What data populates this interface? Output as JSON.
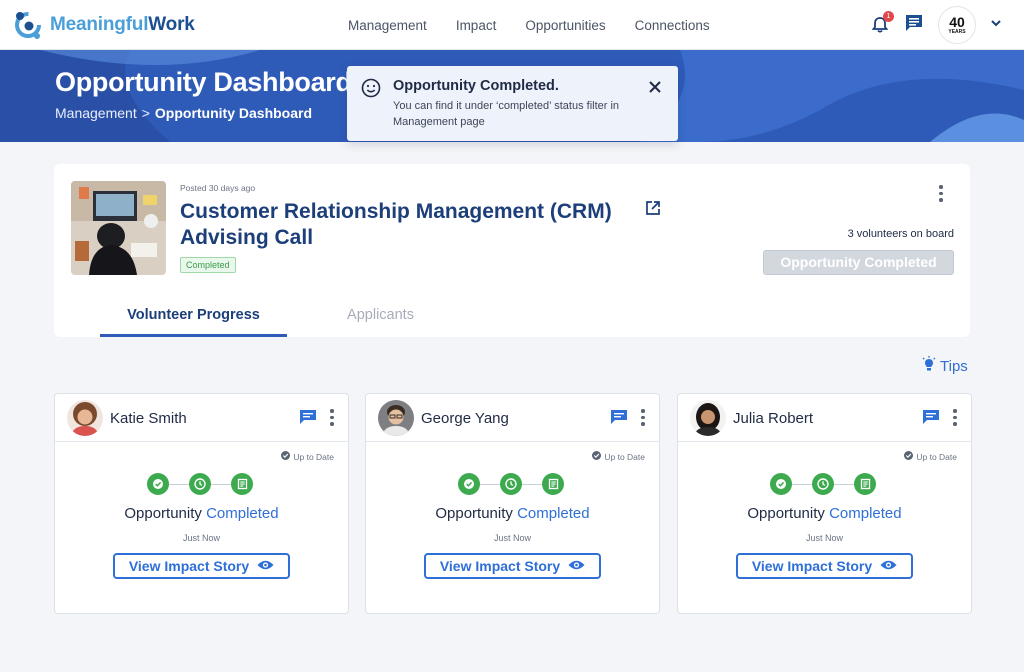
{
  "brand": {
    "name_part1": "Meaningful",
    "name_part2": "Work"
  },
  "nav": {
    "links": [
      "Management",
      "Impact",
      "Opportunities",
      "Connections"
    ],
    "notification_count": "1",
    "org_badge_big": "40",
    "org_badge_small": "YEARS"
  },
  "banner": {
    "title": "Opportunity Dashboard",
    "breadcrumb_parent": "Management",
    "breadcrumb_sep": ">",
    "breadcrumb_current": "Opportunity Dashboard"
  },
  "toast": {
    "title": "Opportunity Completed.",
    "body": "You can find it under ‘completed’ status filter in Management page"
  },
  "opportunity": {
    "posted": "Posted 30 days ago",
    "title": "Customer Relationship Management (CRM) Advising Call",
    "status_chip": "Completed",
    "volunteers": "3 volunteers on board",
    "completed_button": "Opportunity Completed"
  },
  "tabs": [
    {
      "label": "Volunteer Progress",
      "active": true
    },
    {
      "label": "Applicants",
      "active": false
    }
  ],
  "tips_label": "Tips",
  "volunteers": [
    {
      "name": "Katie Smith",
      "sync": "Up to Date",
      "status_prefix": "Opportunity",
      "status_word": "Completed",
      "time": "Just Now",
      "button": "View Impact Story"
    },
    {
      "name": "George Yang",
      "sync": "Up to Date",
      "status_prefix": "Opportunity",
      "status_word": "Completed",
      "time": "Just Now",
      "button": "View Impact Story"
    },
    {
      "name": "Julia Robert",
      "sync": "Up to Date",
      "status_prefix": "Opportunity",
      "status_word": "Completed",
      "time": "Just Now",
      "button": "View Impact Story"
    }
  ],
  "colors": {
    "primary": "#2f5bb8",
    "accent": "#2f6fd8",
    "success": "#3eaa4f",
    "title": "#1c3f7a"
  }
}
